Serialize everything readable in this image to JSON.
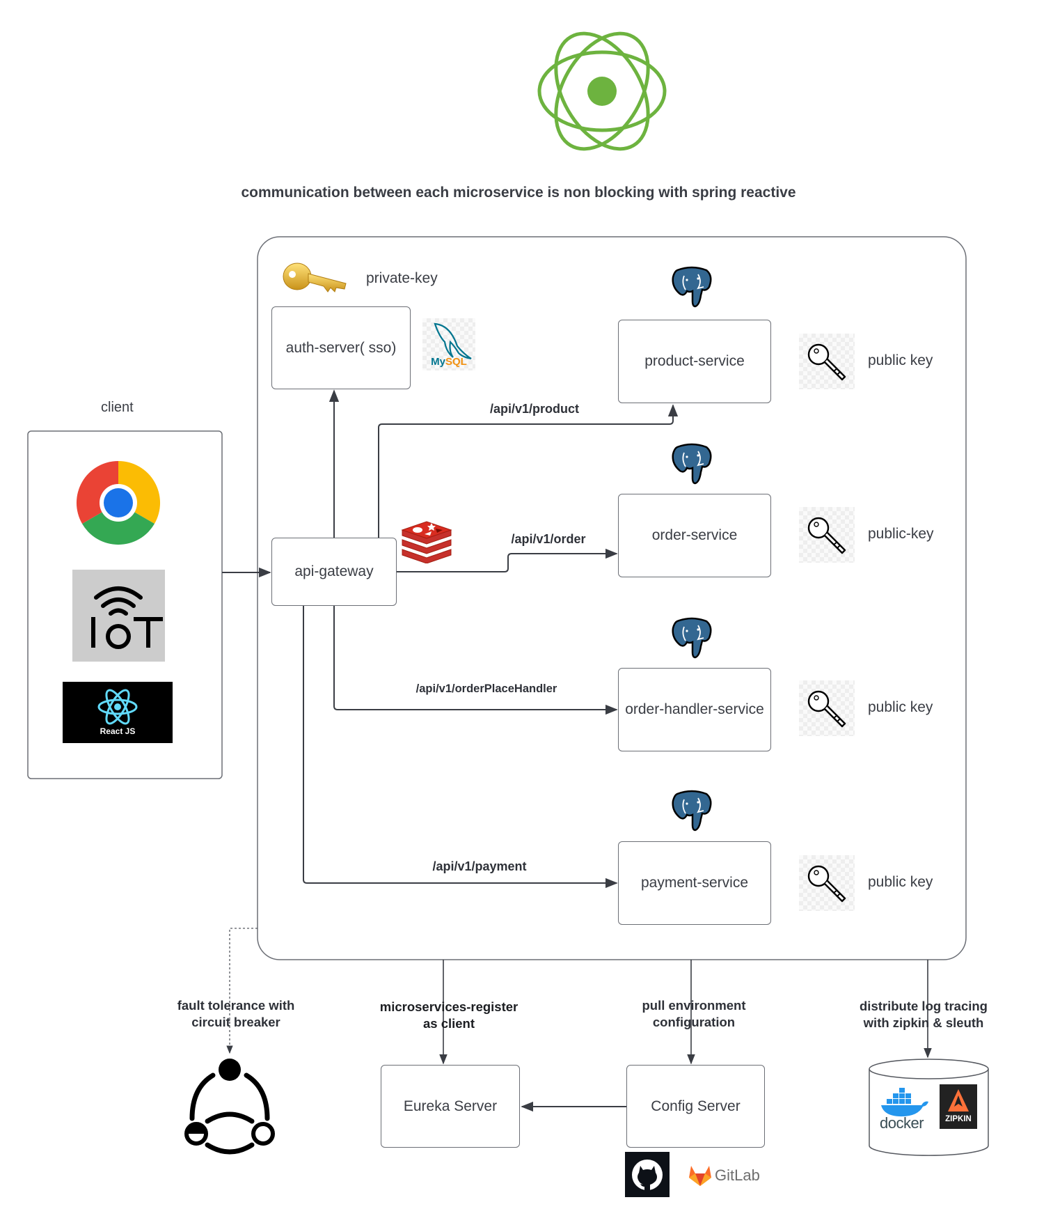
{
  "title": "communication between each microservice is non blocking with spring reactive",
  "colors": {
    "spring_green": "#6db33f",
    "line": "#3a3d44",
    "postgres_blue": "#336791",
    "redis_red": "#d82c20",
    "mysql_blue": "#00758f",
    "mysql_orange": "#f29111",
    "docker_blue": "#2496ed",
    "zipkin_orange": "#fe7139",
    "gitlab_orange": "#fc6d26"
  },
  "client": {
    "label": "client",
    "items": [
      {
        "icon": "chrome-icon"
      },
      {
        "icon": "iot-icon",
        "text": "IOT"
      },
      {
        "icon": "react-icon",
        "text": "React JS"
      }
    ]
  },
  "auth": {
    "box_label": "auth-server( sso)",
    "key_label": "private-key",
    "db_logo_text": "MySQL"
  },
  "gateway": {
    "label": "api-gateway",
    "cache_icon": "redis-icon"
  },
  "services": [
    {
      "label": "product-service",
      "key_label": "public key",
      "route": "/api/v1/product"
    },
    {
      "label": "order-service",
      "key_label": "public-key",
      "route": "/api/v1/order"
    },
    {
      "label": "order-handler-service",
      "key_label": "public key",
      "route": "/api/v1/orderPlaceHandler"
    },
    {
      "label": "payment-service",
      "key_label": "public key",
      "route": "/api/v1/payment"
    }
  ],
  "bottom": {
    "circuit_note": [
      "fault tolerance with",
      "circuit breaker"
    ],
    "eureka_note": [
      "microservices-register",
      "as client"
    ],
    "config_note": [
      "pull environment",
      "configuration"
    ],
    "tracing_note": [
      "distribute log tracing",
      "with zipkin & sleuth"
    ],
    "eureka_label": "Eureka Server",
    "config_label": "Config Server",
    "gitlab_text": "GitLab",
    "docker_text": "docker",
    "zipkin_text": "ZIPKIN"
  }
}
